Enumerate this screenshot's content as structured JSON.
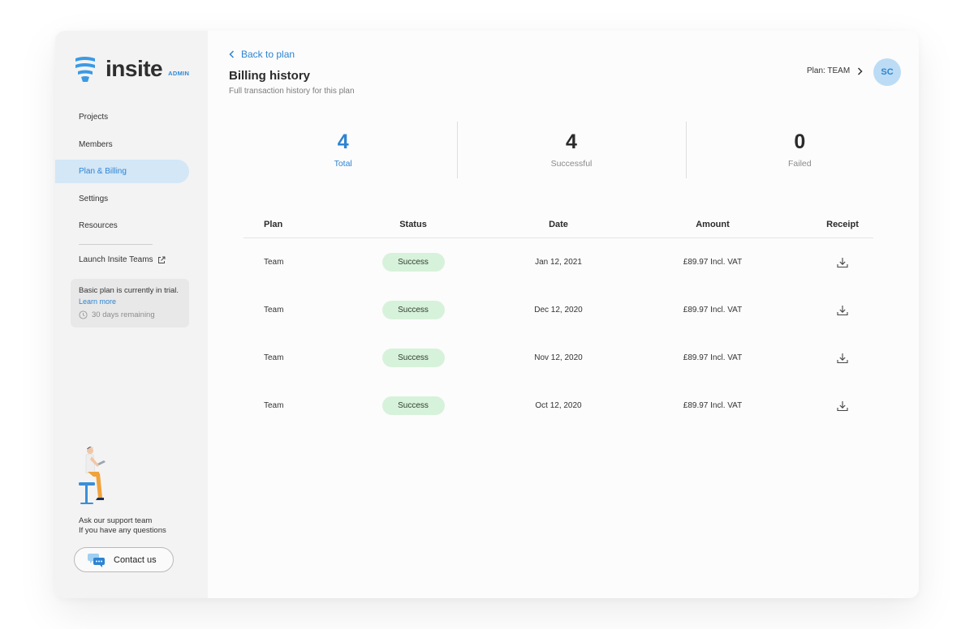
{
  "brand": {
    "name": "insite",
    "tag": "ADMIN",
    "logo_icon": "insite-logo-icon",
    "accent": "#2d84d2"
  },
  "sidebar": {
    "items": [
      {
        "label": "Projects",
        "active": false
      },
      {
        "label": "Members",
        "active": false
      },
      {
        "label": "Plan & Billing",
        "active": true
      },
      {
        "label": "Settings",
        "active": false
      },
      {
        "label": "Resources",
        "active": false
      }
    ],
    "launch_label": "Launch Insite Teams",
    "trial": {
      "text": "Basic plan is currently in trial.",
      "link": "Learn more",
      "remaining": "30 days remaining"
    },
    "support_line1": "Ask our support team",
    "support_line2": "If you have any questions",
    "contact_label": "Contact us"
  },
  "header": {
    "back_label": "Back to plan",
    "title": "Billing history",
    "subtitle": "Full transaction history for this plan",
    "plan_label": "Plan: TEAM",
    "avatar_initials": "SC"
  },
  "stats": [
    {
      "value": "4",
      "label": "Total"
    },
    {
      "value": "4",
      "label": "Successful"
    },
    {
      "value": "0",
      "label": "Failed"
    }
  ],
  "table": {
    "headers": {
      "plan": "Plan",
      "status": "Status",
      "date": "Date",
      "amount": "Amount",
      "receipt": "Receipt"
    },
    "rows": [
      {
        "plan": "Team",
        "status": "Success",
        "date": "Jan 12, 2021",
        "amount": "£89.97 Incl. VAT"
      },
      {
        "plan": "Team",
        "status": "Success",
        "date": "Dec 12, 2020",
        "amount": "£89.97 Incl. VAT"
      },
      {
        "plan": "Team",
        "status": "Success",
        "date": "Nov 12, 2020",
        "amount": "£89.97 Incl. VAT"
      },
      {
        "plan": "Team",
        "status": "Success",
        "date": "Oct 12, 2020",
        "amount": "£89.97 Incl. VAT"
      }
    ]
  },
  "colors": {
    "success_bg": "#d7f2da",
    "active_nav_bg": "#d3e7f7",
    "avatar_bg": "#bcdcf5"
  }
}
